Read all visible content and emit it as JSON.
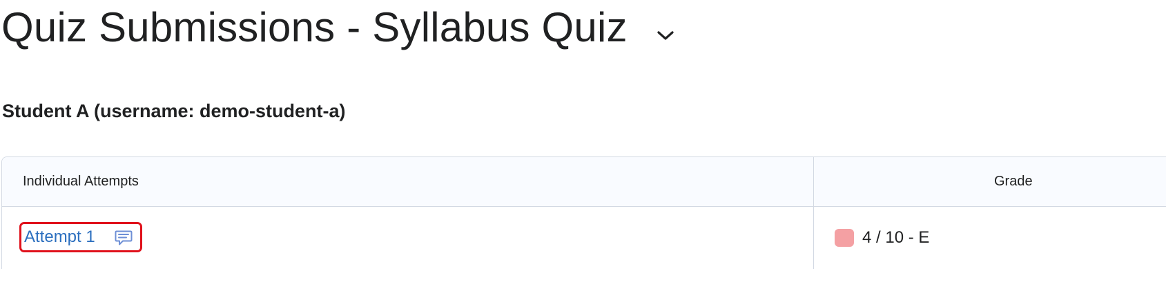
{
  "page": {
    "title": "Quiz Submissions - Syllabus Quiz"
  },
  "student": {
    "heading": "Student A (username: demo-student-a)"
  },
  "table": {
    "columns": [
      "Individual Attempts",
      "Grade"
    ],
    "rows": [
      {
        "attempt_label": "Attempt 1",
        "grade_text": "4 / 10 - E",
        "grade_color": "#f4a0a3",
        "feedback_icon": "feedback-comment-icon"
      }
    ]
  },
  "colors": {
    "link": "#2c6fbf",
    "highlight": "#e0121c",
    "header_bg": "#f9fbff",
    "border": "#d3d9e3",
    "icon": "#6e8fd6"
  }
}
